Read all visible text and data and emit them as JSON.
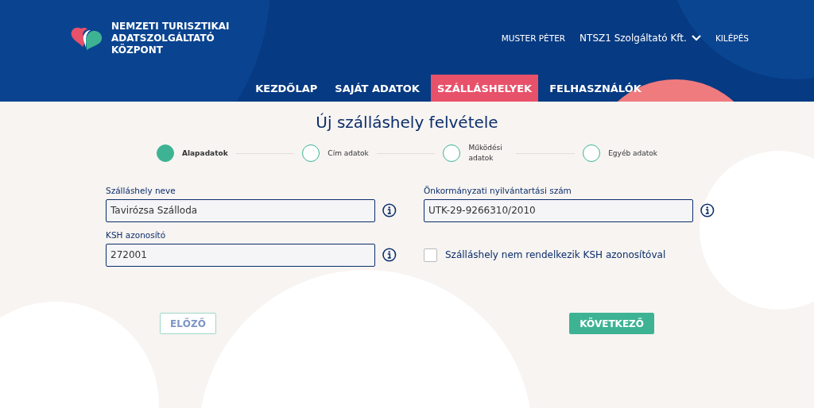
{
  "header": {
    "logo_text": "NEMZETI TURISZTIKAI ADATSZOLGÁLTATÓ KÖZPONT",
    "user": "MUSTER PÉTER",
    "organization": "NTSZ1 Szolgáltató Kft.",
    "logout": "KILÉPÉS"
  },
  "nav": [
    {
      "label": "KEZDŐLAP",
      "selected": false
    },
    {
      "label": "SAJÁT ADATOK",
      "selected": false
    },
    {
      "label": "SZÁLLÁSHELYEK",
      "selected": true
    },
    {
      "label": "FELHASZNÁLÓK",
      "selected": false
    }
  ],
  "title": "Új szálláshely felvétele",
  "steps": [
    {
      "label": "Alapadatok",
      "selected": true
    },
    {
      "label": "Cím adatok",
      "selected": false
    },
    {
      "label": "Működési adatok",
      "selected": false
    },
    {
      "label": "Egyéb adatok",
      "selected": false
    }
  ],
  "fields": [
    {
      "label": "Szálláshely neve",
      "value": "Tavirózsa Szálloda"
    },
    {
      "label": "Önkormányzati nyilvántartási szám",
      "value": "UTK-29-9266310/2010"
    },
    {
      "label": "KSH azonosító",
      "value": "272001"
    }
  ],
  "checkbox": {
    "label": "Szálláshely nem rendelkezik KSH azonosítóval",
    "checked": false
  },
  "buttons": {
    "previous": {
      "label": "ELŐZŐ",
      "disabled": true
    },
    "next": {
      "label": "KÖVETKEZŐ",
      "disabled": false
    }
  }
}
